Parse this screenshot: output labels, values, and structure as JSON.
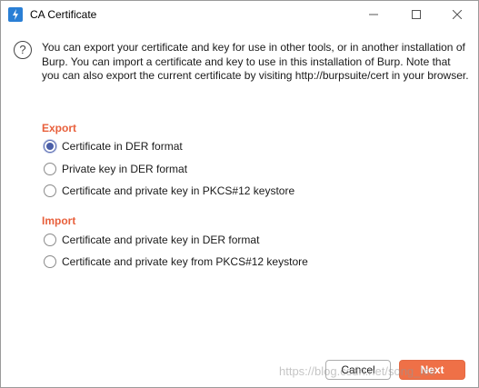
{
  "window": {
    "title": "CA Certificate",
    "controls": {
      "minimize_icon": "minimize-icon",
      "maximize_icon": "maximize-icon",
      "close_icon": "close-icon"
    }
  },
  "intro": {
    "help_icon": "?",
    "text": "You can export your certificate and key for use in other tools, or in another installation of Burp. You can import a certificate and key to use in this installation of Burp. Note that you can also export the current certificate by visiting http://burpsuite/cert in your browser."
  },
  "export": {
    "heading": "Export",
    "options": [
      {
        "label": "Certificate in DER format",
        "selected": true
      },
      {
        "label": "Private key in DER format",
        "selected": false
      },
      {
        "label": "Certificate and private key in PKCS#12 keystore",
        "selected": false
      }
    ]
  },
  "import": {
    "heading": "Import",
    "options": [
      {
        "label": "Certificate and private key in DER format",
        "selected": false
      },
      {
        "label": "Certificate and private key from PKCS#12 keystore",
        "selected": false
      }
    ]
  },
  "buttons": {
    "cancel": "Cancel",
    "next": "Next"
  },
  "watermark": "https://blog.csdn.net/song_lee",
  "colors": {
    "accent": "#ef7047",
    "section_heading": "#e8603c",
    "radio_selected": "#4a5ea8",
    "app_icon": "#2a7fd5"
  }
}
